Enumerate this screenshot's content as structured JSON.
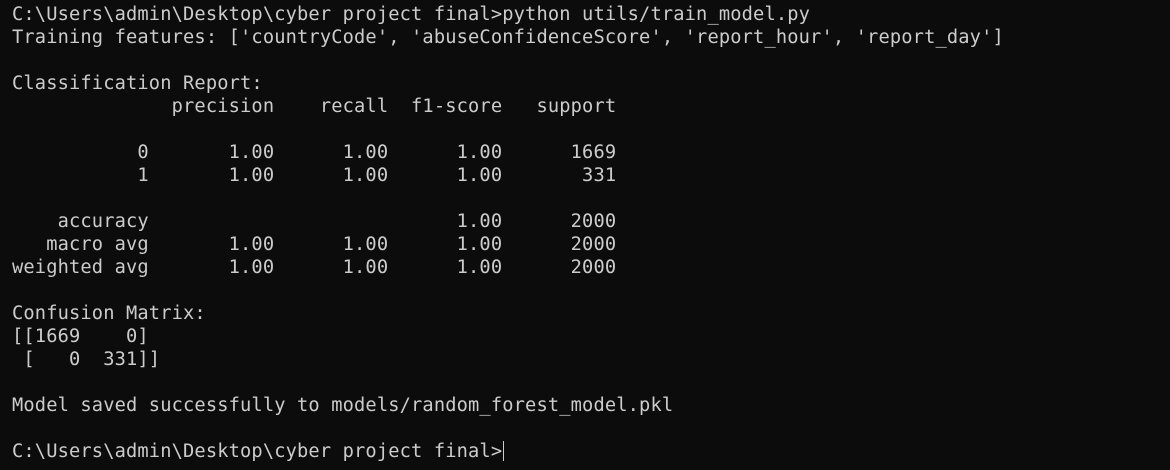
{
  "terminal": {
    "lines": [
      "C:\\Users\\admin\\Desktop\\cyber project final>python utils/train_model.py",
      "Training features: ['countryCode', 'abuseConfidenceScore', 'report_hour', 'report_day']",
      "",
      "Classification Report:",
      "              precision    recall  f1-score   support",
      "",
      "           0       1.00      1.00      1.00      1669",
      "           1       1.00      1.00      1.00       331",
      "",
      "    accuracy                           1.00      2000",
      "   macro avg       1.00      1.00      1.00      2000",
      "weighted avg       1.00      1.00      1.00      2000",
      "",
      "Confusion Matrix:",
      "[[1669    0]",
      " [   0  331]]",
      "",
      "Model saved successfully to models/random_forest_model.pkl",
      "",
      "C:\\Users\\admin\\Desktop\\cyber project final>"
    ]
  },
  "colors": {
    "background": "#0c0c0c",
    "foreground": "#cccccc"
  }
}
